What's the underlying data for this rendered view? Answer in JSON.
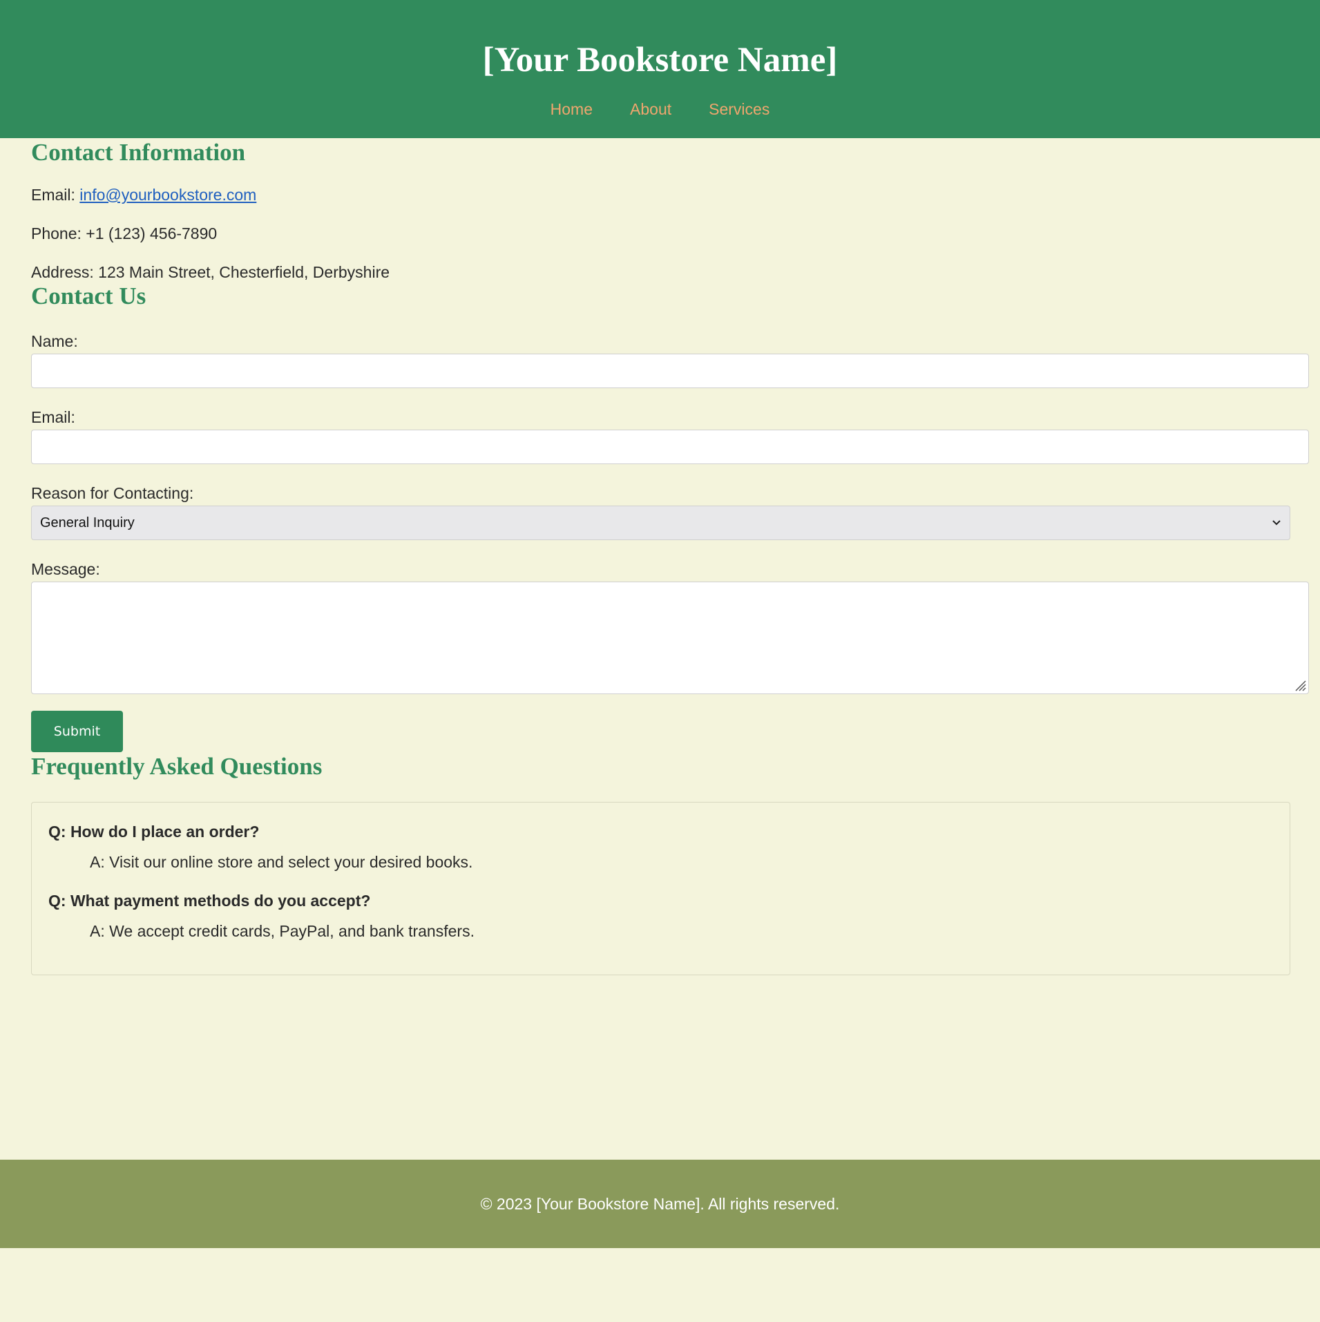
{
  "header": {
    "site_title": "[Your Bookstore Name]",
    "nav": [
      {
        "label": "Home"
      },
      {
        "label": "About"
      },
      {
        "label": "Services"
      }
    ]
  },
  "contact_info": {
    "title": "Contact Information",
    "email_label": "Email:",
    "email_value": "info@yourbookstore.com",
    "phone": "Phone: +1 (123) 456-7890",
    "address": "Address: 123 Main Street, Chesterfield, Derbyshire"
  },
  "contact_form": {
    "title": "Contact Us",
    "name_label": "Name:",
    "name_value": "",
    "email_label": "Email:",
    "email_value": "",
    "reason_label": "Reason for Contacting:",
    "reason_selected": "General Inquiry",
    "message_label": "Message:",
    "message_value": "",
    "submit_label": "Submit"
  },
  "faq": {
    "title": "Frequently Asked Questions",
    "items": [
      {
        "q": "Q: How do I place an order?",
        "a": "A: Visit our online store and select your desired books."
      },
      {
        "q": "Q: What payment methods do you accept?",
        "a": "A: We accept credit cards, PayPal, and bank transfers."
      }
    ]
  },
  "footer": {
    "text": "© 2023 [Your Bookstore Name]. All rights reserved."
  },
  "colors": {
    "header_bg": "#318b5c",
    "nav_link": "#f0a66e",
    "page_bg": "#f4f4dc",
    "heading": "#318b5c",
    "footer_bg": "#8a9a5b",
    "link": "#1f5fbf"
  },
  "icons": {
    "select_arrow": "chevron-down-icon",
    "textarea_resize": "resize-handle-icon"
  }
}
